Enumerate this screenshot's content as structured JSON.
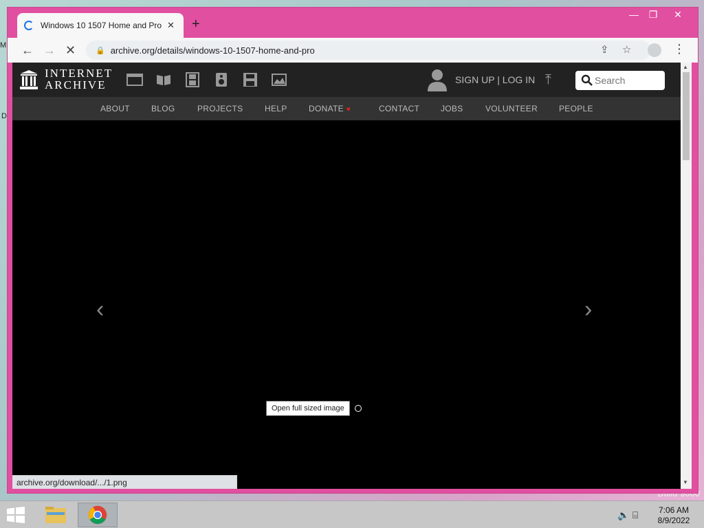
{
  "browser": {
    "tab_title": "Windows 10 1507 Home and Pro",
    "tab_close": "✕",
    "new_tab": "+",
    "url": "archive.org/details/windows-10-1507-home-and-pro",
    "window_controls": {
      "minimize": "—",
      "maximize": "❐",
      "close": "✕"
    }
  },
  "site": {
    "logo_line1": "INTERNET",
    "logo_line2": "ARCHIVE",
    "signin": "SIGN UP | LOG IN",
    "search_placeholder": "Search",
    "nav": [
      "ABOUT",
      "BLOG",
      "PROJECTS",
      "HELP",
      "DONATE",
      "CONTACT",
      "JOBS",
      "VOLUNTEER",
      "PEOPLE"
    ]
  },
  "theater": {
    "tooltip": "Open full sized image",
    "status_url": "archive.org/download/.../1.png"
  },
  "desktop": {
    "frag1": "M",
    "frag2": "D",
    "build": "Build 9600"
  },
  "taskbar": {
    "time": "7:06 AM",
    "date": "8/9/2022"
  },
  "colors": {
    "window_frame": "#e14fa0",
    "ia_header": "#222222",
    "donate_heart": "#e0261c"
  }
}
